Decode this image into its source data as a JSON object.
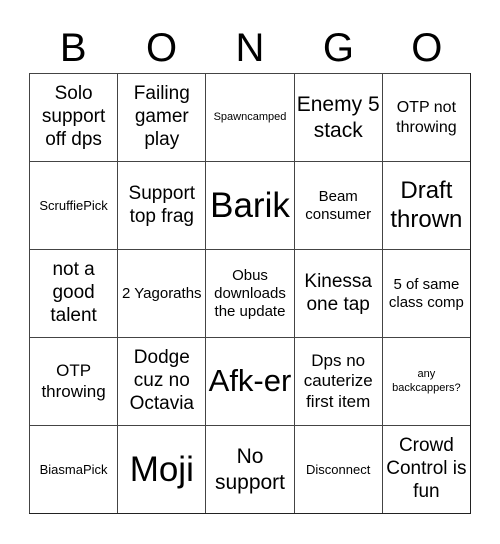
{
  "title_letters": [
    "B",
    "O",
    "N",
    "G",
    "O"
  ],
  "cells": [
    [
      "Solo support off dps",
      "Failing gamer play",
      "Spawncamped",
      "Enemy 5 stack",
      "OTP not throwing"
    ],
    [
      "ScruffiePick",
      "Support top frag",
      "Barik",
      "Beam consumer",
      "Draft thrown"
    ],
    [
      "not a good talent",
      "2 Yagoraths",
      "Obus downloads the update",
      "Kinessa one tap",
      "5 of same class comp"
    ],
    [
      "OTP throwing",
      "Dodge cuz no Octavia",
      "Afk-er",
      "Dps no cauterize first item",
      "any backcappers?"
    ],
    [
      "BiasmaPick",
      "Moji",
      "No support",
      "Disconnect",
      "Crowd Control is fun"
    ]
  ]
}
